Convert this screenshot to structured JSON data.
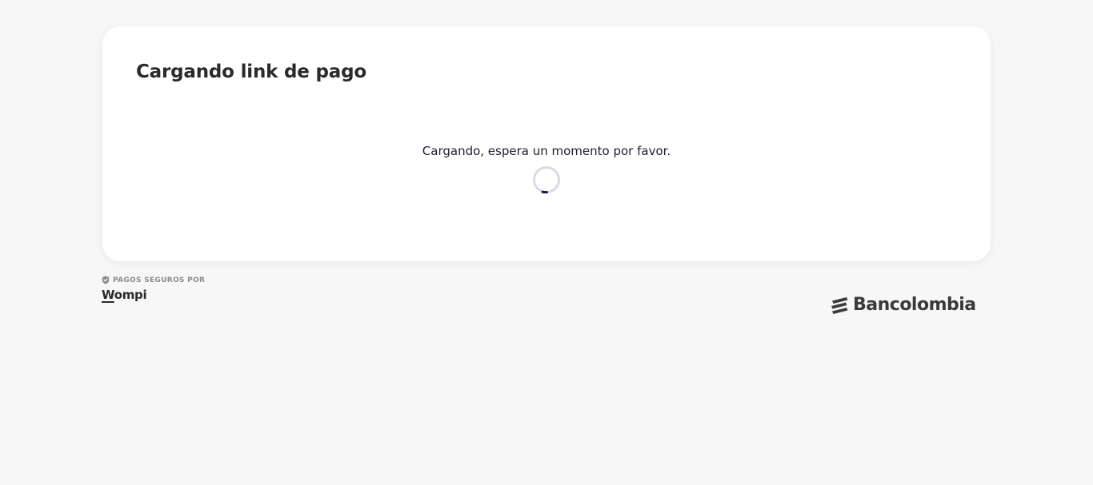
{
  "card": {
    "title": "Cargando link de pago",
    "loading_message": "Cargando, espera un momento por favor."
  },
  "footer": {
    "secure_label": "PAGOS SEGUROS POR",
    "provider_logo_text": "Wompi",
    "bank_logo_text": "Bancolombia"
  },
  "colors": {
    "background": "#f7f7f7",
    "card": "#ffffff",
    "spinner_track": "#dcd8e8",
    "spinner_accent": "#2c0e5c",
    "text_dark": "#2c2a29",
    "muted": "#8c8a92"
  },
  "icons": {
    "secure": "shield-check-icon",
    "bank": "bancolombia-stripes-icon"
  }
}
